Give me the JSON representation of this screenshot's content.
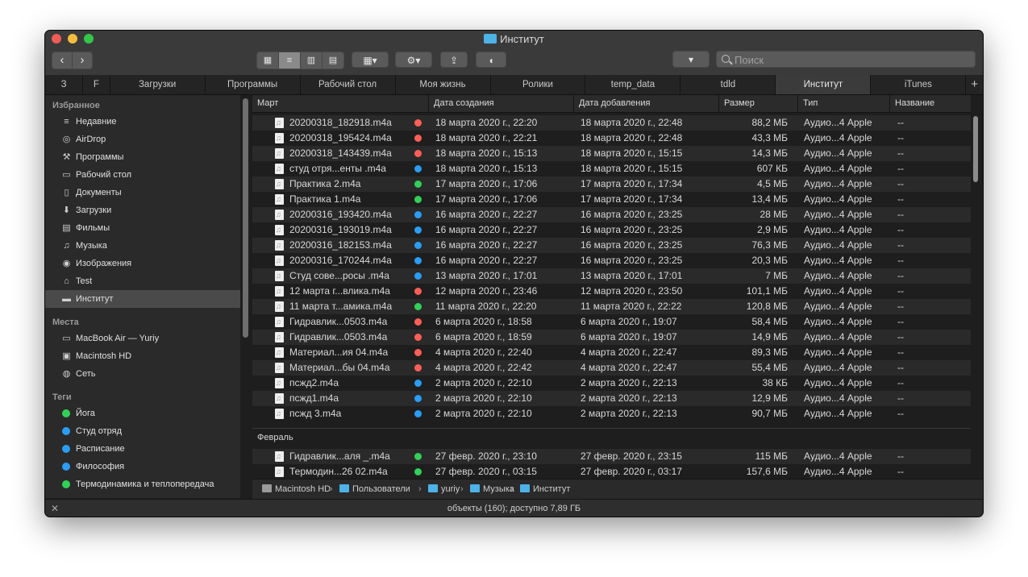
{
  "window": {
    "title": "Институт"
  },
  "toolbar": {
    "back": "‹",
    "forward": "›",
    "view_icons": [
      "▦",
      "≡",
      "▥",
      "▤"
    ],
    "arrange_icon": "▦▾",
    "action_icon": "⚙▾",
    "share_icon": "⇪",
    "tag_icon": "◖",
    "search_placeholder": "Поиск",
    "dropdown_label": "▾"
  },
  "tabs": [
    "З",
    "F",
    "Загрузки",
    "Программы",
    "Рабочий стол",
    "Моя жизнь",
    "Ролики",
    "temp_data",
    "tdld",
    "Институт",
    "iTunes"
  ],
  "tab_add": "+",
  "sidebar": {
    "favorites_header": "Избранное",
    "favorites": [
      {
        "icon": "≡",
        "label": "Недавние"
      },
      {
        "icon": "◎",
        "label": "AirDrop"
      },
      {
        "icon": "⚒",
        "label": "Программы"
      },
      {
        "icon": "▭",
        "label": "Рабочий стол"
      },
      {
        "icon": "▯",
        "label": "Документы"
      },
      {
        "icon": "⬇",
        "label": "Загрузки"
      },
      {
        "icon": "▤",
        "label": "Фильмы"
      },
      {
        "icon": "♫",
        "label": "Музыка"
      },
      {
        "icon": "◉",
        "label": "Изображения"
      },
      {
        "icon": "⌂",
        "label": "Test"
      },
      {
        "icon": "▬",
        "label": "Институт"
      }
    ],
    "places_header": "Места",
    "places": [
      {
        "icon": "▭",
        "label": "MacBook Air — Yuriy"
      },
      {
        "icon": "▣",
        "label": "Macintosh HD"
      },
      {
        "icon": "◍",
        "label": "Сеть"
      }
    ],
    "tags_header": "Теги",
    "tags": [
      {
        "color": "#31d158",
        "label": "Йога"
      },
      {
        "color": "#2a9df4",
        "label": "Студ отряд"
      },
      {
        "color": "#2a9df4",
        "label": "Расписание"
      },
      {
        "color": "#2a9df4",
        "label": "Философия"
      },
      {
        "color": "#31d158",
        "label": "Термодинамика и теплопередача"
      }
    ]
  },
  "columns": [
    "Март",
    "Дата создания",
    "Дата добавления",
    "Размер",
    "Тип",
    "Название"
  ],
  "tag_colors": {
    "red": "#ff5f57",
    "blue": "#2a9df4",
    "green": "#31d158"
  },
  "march_rows": [
    {
      "name": "20200318_182918.m4a",
      "tag": "red",
      "created": "18 марта 2020 г., 22:20",
      "added": "18 марта 2020 г., 22:48",
      "size": "88,2 МБ",
      "type": "Аудио...4 Apple",
      "title": "--"
    },
    {
      "name": "20200318_195424.m4a",
      "tag": "red",
      "created": "18 марта 2020 г., 22:21",
      "added": "18 марта 2020 г., 22:48",
      "size": "43,3 МБ",
      "type": "Аудио...4 Apple",
      "title": "--"
    },
    {
      "name": "20200318_143439.m4a",
      "tag": "red",
      "created": "18 марта 2020 г., 15:13",
      "added": "18 марта 2020 г., 15:15",
      "size": "14,3 МБ",
      "type": "Аудио...4 Apple",
      "title": "--"
    },
    {
      "name": "студ отря...енты .m4a",
      "tag": "blue",
      "created": "18 марта 2020 г., 15:13",
      "added": "18 марта 2020 г., 15:15",
      "size": "607 КБ",
      "type": "Аудио...4 Apple",
      "title": "--"
    },
    {
      "name": "Практика 2.m4a",
      "tag": "green",
      "created": "17 марта 2020 г., 17:06",
      "added": "17 марта 2020 г., 17:34",
      "size": "4,5 МБ",
      "type": "Аудио...4 Apple",
      "title": "--"
    },
    {
      "name": "Практика 1.m4a",
      "tag": "green",
      "created": "17 марта 2020 г., 17:06",
      "added": "17 марта 2020 г., 17:34",
      "size": "13,4 МБ",
      "type": "Аудио...4 Apple",
      "title": "--"
    },
    {
      "name": "20200316_193420.m4a",
      "tag": "blue",
      "created": "16 марта 2020 г., 22:27",
      "added": "16 марта 2020 г., 23:25",
      "size": "28 МБ",
      "type": "Аудио...4 Apple",
      "title": "--"
    },
    {
      "name": "20200316_193019.m4a",
      "tag": "blue",
      "created": "16 марта 2020 г., 22:27",
      "added": "16 марта 2020 г., 23:25",
      "size": "2,9 МБ",
      "type": "Аудио...4 Apple",
      "title": "--"
    },
    {
      "name": "20200316_182153.m4a",
      "tag": "blue",
      "created": "16 марта 2020 г., 22:27",
      "added": "16 марта 2020 г., 23:25",
      "size": "76,3 МБ",
      "type": "Аудио...4 Apple",
      "title": "--"
    },
    {
      "name": "20200316_170244.m4a",
      "tag": "blue",
      "created": "16 марта 2020 г., 22:27",
      "added": "16 марта 2020 г., 23:25",
      "size": "20,3 МБ",
      "type": "Аудио...4 Apple",
      "title": "--"
    },
    {
      "name": "Студ сове...росы .m4a",
      "tag": "blue",
      "created": "13 марта 2020 г., 17:01",
      "added": "13 марта 2020 г., 17:01",
      "size": "7 МБ",
      "type": "Аудио...4 Apple",
      "title": "--"
    },
    {
      "name": "12 марта г...влика.m4a",
      "tag": "red",
      "created": "12 марта 2020 г., 23:46",
      "added": "12 марта 2020 г., 23:50",
      "size": "101,1 МБ",
      "type": "Аудио...4 Apple",
      "title": "--"
    },
    {
      "name": "11 марта т...амика.m4a",
      "tag": "green",
      "created": "11 марта 2020 г., 22:20",
      "added": "11 марта 2020 г., 22:22",
      "size": "120,8 МБ",
      "type": "Аудио...4 Apple",
      "title": "--"
    },
    {
      "name": "Гидравлик...0503.m4a",
      "tag": "red",
      "created": "6 марта 2020 г., 18:58",
      "added": "6 марта 2020 г., 19:07",
      "size": "58,4 МБ",
      "type": "Аудио...4 Apple",
      "title": "--"
    },
    {
      "name": "Гидравлик...0503.m4a",
      "tag": "red",
      "created": "6 марта 2020 г., 18:59",
      "added": "6 марта 2020 г., 19:07",
      "size": "14,9 МБ",
      "type": "Аудио...4 Apple",
      "title": "--"
    },
    {
      "name": "Материал...ия 04.m4a",
      "tag": "red",
      "created": "4 марта 2020 г., 22:40",
      "added": "4 марта 2020 г., 22:47",
      "size": "89,3 МБ",
      "type": "Аудио...4 Apple",
      "title": "--"
    },
    {
      "name": "Материал...бы 04.m4a",
      "tag": "red",
      "created": "4 марта 2020 г., 22:42",
      "added": "4 марта 2020 г., 22:47",
      "size": "55,4 МБ",
      "type": "Аудио...4 Apple",
      "title": "--"
    },
    {
      "name": "псжд2.m4a",
      "tag": "blue",
      "created": "2 марта 2020 г., 22:10",
      "added": "2 марта 2020 г., 22:13",
      "size": "38 КБ",
      "type": "Аудио...4 Apple",
      "title": "--"
    },
    {
      "name": "псжд1.m4a",
      "tag": "blue",
      "created": "2 марта 2020 г., 22:10",
      "added": "2 марта 2020 г., 22:13",
      "size": "12,9 МБ",
      "type": "Аудио...4 Apple",
      "title": "--"
    },
    {
      "name": "псжд 3.m4a",
      "tag": "blue",
      "created": "2 марта 2020 г., 22:10",
      "added": "2 марта 2020 г., 22:13",
      "size": "90,7 МБ",
      "type": "Аудио...4 Apple",
      "title": "--"
    }
  ],
  "february_header": "Февраль",
  "february_rows": [
    {
      "name": "Гидравлик...аля _.m4a",
      "tag": "green",
      "created": "27 февр. 2020 г., 23:10",
      "added": "27 февр. 2020 г., 23:15",
      "size": "115 МБ",
      "type": "Аудио...4 Apple",
      "title": "--"
    },
    {
      "name": "Термодин...26 02.m4a",
      "tag": "green",
      "created": "27 февр. 2020 г., 03:15",
      "added": "27 февр. 2020 г., 03:17",
      "size": "157,6 МБ",
      "type": "Аудио...4 Apple",
      "title": "--"
    }
  ],
  "path": [
    {
      "label": "Macintosh HD",
      "color": "#9a9a9a"
    },
    {
      "label": "Пользователи",
      "color": "#4db2e8"
    },
    {
      "label": "yuriy",
      "color": "#4db2e8"
    },
    {
      "label": "Музыка",
      "color": "#4db2e8"
    },
    {
      "label": "Институт",
      "color": "#4db2e8"
    }
  ],
  "status": {
    "text": "объекты (160); доступно 7,89 ГБ",
    "icon": "✕"
  }
}
